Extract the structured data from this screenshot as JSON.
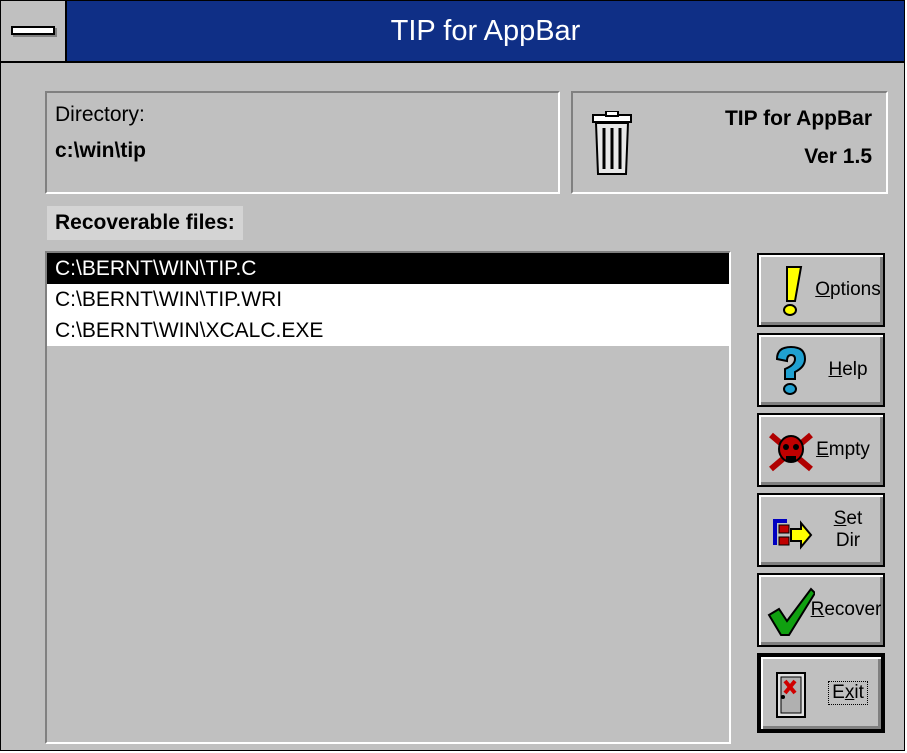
{
  "window": {
    "title": "TIP for AppBar"
  },
  "directory": {
    "label": "Directory:",
    "value": "c:\\win\\tip"
  },
  "info": {
    "title": "TIP for AppBar",
    "version": "Ver 1.5"
  },
  "files": {
    "label": "Recoverable files:",
    "items": [
      {
        "path": "C:\\BERNT\\WIN\\TIP.C",
        "selected": true
      },
      {
        "path": "C:\\BERNT\\WIN\\TIP.WRI",
        "selected": false
      },
      {
        "path": "C:\\BERNT\\WIN\\XCALC.EXE",
        "selected": false
      }
    ]
  },
  "buttons": {
    "options": {
      "mnemonic": "O",
      "rest": "ptions",
      "icon": "exclamation-icon"
    },
    "help": {
      "mnemonic": "H",
      "rest": "elp",
      "icon": "question-icon"
    },
    "empty": {
      "mnemonic": "E",
      "rest": "mpty",
      "icon": "skull-icon"
    },
    "setdir": {
      "mnemonic": "S",
      "rest": "et",
      "line2": "Dir",
      "icon": "folder-arrow-icon"
    },
    "recover": {
      "mnemonic": "R",
      "rest": "ecover",
      "icon": "checkmark-icon"
    },
    "exit": {
      "pre": "E",
      "mnemonic": "x",
      "rest": "it",
      "icon": "exit-door-icon"
    }
  }
}
